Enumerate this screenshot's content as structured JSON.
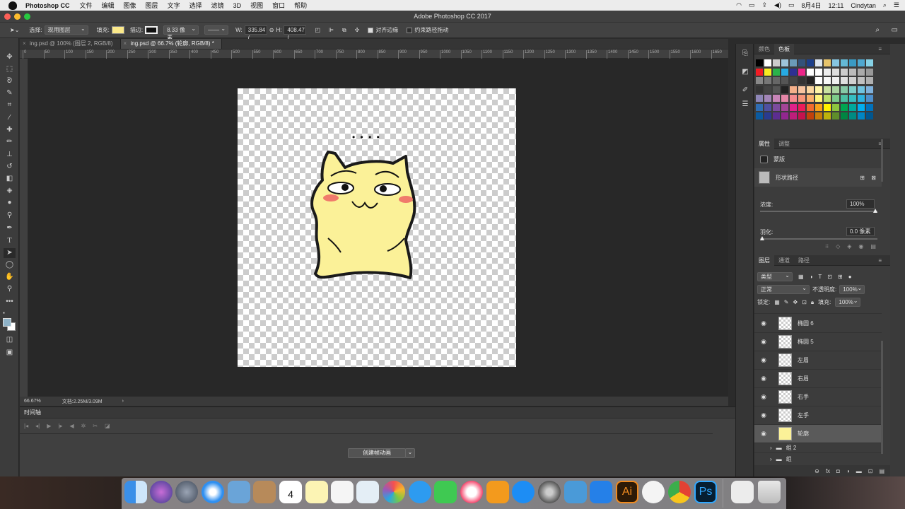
{
  "menubar": {
    "app_name": "Photoshop CC",
    "items": [
      "文件",
      "编辑",
      "图像",
      "图层",
      "文字",
      "选择",
      "滤镜",
      "3D",
      "视图",
      "窗口",
      "帮助"
    ],
    "date": "8月4日",
    "time": "12:11",
    "user": "Cindytan"
  },
  "window": {
    "title": "Adobe Photoshop CC 2017"
  },
  "options": {
    "select_label": "选择:",
    "select_value": "现用图层",
    "fill_label": "填充:",
    "fill_color": "#fbe98a",
    "stroke_label": "描边:",
    "stroke_width": "8.33 像素",
    "w_label": "W:",
    "w_value": "335.84 (",
    "h_label": "H:",
    "h_value": "408.47 (",
    "align_edges_label": "对齐边缘",
    "constrain_path_label": "约束路径拖动"
  },
  "tabs": [
    {
      "label": "ing.psd @ 100% (图层 2, RGB/8)"
    },
    {
      "label": "ing.psd @ 66.7% (轮廓, RGB/8) *"
    }
  ],
  "ruler": {
    "ticks": [
      "0",
      "50",
      "100",
      "150",
      "200",
      "250",
      "300",
      "350",
      "400",
      "450",
      "500",
      "550",
      "600",
      "650",
      "700",
      "750",
      "800",
      "850",
      "900",
      "950",
      "1000",
      "1050",
      "1100",
      "1150",
      "1200",
      "1250",
      "1300",
      "1350",
      "1400",
      "1450",
      "1500",
      "1550",
      "1600",
      "1650"
    ]
  },
  "status": {
    "zoom": "66.67%",
    "doc": "文档:2.25M/3.09M",
    "arrow": "›"
  },
  "timeline": {
    "title": "时间轴",
    "create_button": "创建帧动画"
  },
  "swatches_panel": {
    "tabs": [
      "颜色",
      "色板"
    ]
  },
  "properties_panel": {
    "tabs": [
      "属性",
      "调整"
    ],
    "mask_label": "蒙版",
    "shape_path_label": "形状路径",
    "density_label": "浓度:",
    "density_value": "100%",
    "feather_label": "羽化:",
    "feather_value": "0.0 像素"
  },
  "layers_panel": {
    "tabs": [
      "图层",
      "通道",
      "路径"
    ],
    "filter_label": "类型",
    "blend_mode": "正常",
    "opacity_label": "不透明度:",
    "opacity_value": "100%",
    "lock_label": "锁定:",
    "fill_label": "填充:",
    "fill_value": "100%",
    "layers": [
      {
        "name": "椭圆 6"
      },
      {
        "name": "椭圆 5"
      },
      {
        "name": "左眉"
      },
      {
        "name": "右眉"
      },
      {
        "name": "右手"
      },
      {
        "name": "左手"
      },
      {
        "name": "轮廓"
      }
    ],
    "groups": [
      {
        "name": "组 2"
      },
      {
        "name": "组"
      }
    ]
  },
  "dock": {
    "illustrator_label": "Ai",
    "photoshop_label": "Ps",
    "calendar_day": "4",
    "calendar_month": "8月"
  },
  "canvas_text": "• • • •"
}
